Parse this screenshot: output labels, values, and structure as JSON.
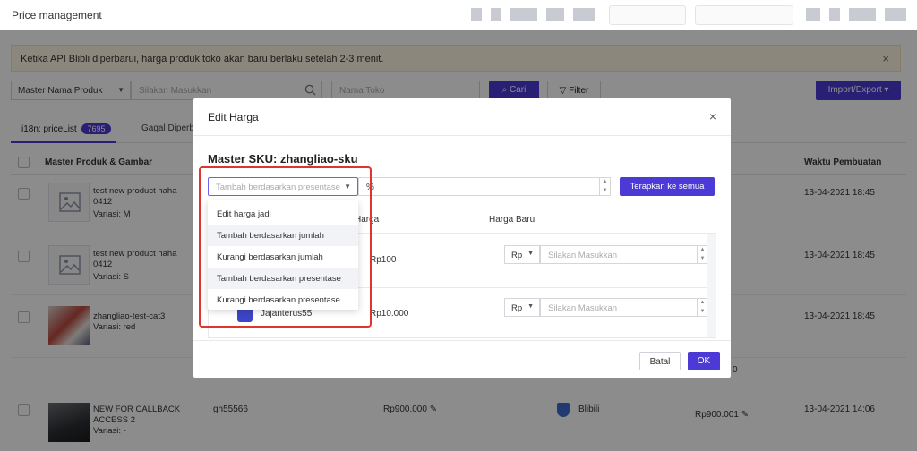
{
  "app": {
    "title": "Price management"
  },
  "notice": {
    "text": "Ketika API Blibli diperbarui, harga produk toko akan baru berlaku setelah 2-3 menit.",
    "close": "×"
  },
  "filters": {
    "master_select": "Master Nama Produk",
    "search_placeholder": "Silakan Masukkan",
    "store_placeholder": "Nama Toko",
    "search_button": "Cari",
    "filter_button": "Filter",
    "import_button": "Import/Export"
  },
  "tabs": [
    {
      "label": "i18n: priceList",
      "count": "7695"
    },
    {
      "label": "Gagal Diperb"
    }
  ],
  "table": {
    "headers": {
      "product": "Master Produk & Gambar",
      "created": "Waktu Pembuatan"
    },
    "rows": [
      {
        "name": "test new product haha 0412",
        "variant": "Variasi: M",
        "date": "13-04-2021 18:45"
      },
      {
        "name": "test new product haha 0412",
        "variant": "Variasi: S",
        "date": "13-04-2021 18:45"
      },
      {
        "name": "zhangliao-test-cat3",
        "variant": "Variasi: red",
        "date": "13-04-2021 18:45",
        "price_new": "0"
      },
      {
        "name": "NEW FOR CALLBACK ACCESS 2",
        "variant": "Variasi: -",
        "sku": "gh55566",
        "price": "Rp900.000",
        "store": "Blibili",
        "price_new": "Rp900.001",
        "date": "13-04-2021 14:06"
      }
    ]
  },
  "modal": {
    "title": "Edit Harga",
    "close": "×",
    "sku_label": "Master SKU: zhangliao-sku",
    "mode_placeholder": "Tambah berdasarkan presentase",
    "pct_suffix": "%",
    "apply_all": "Terapkan ke semua",
    "col_price": "Harga",
    "col_new_price": "Harga Baru",
    "rows": [
      {
        "store": "",
        "price": "Rp100",
        "currency": "Rp",
        "placeholder": "Silakan Masukkan"
      },
      {
        "store": "Jajanterus55",
        "price": "Rp10.000",
        "currency": "Rp",
        "placeholder": "Silakan Masukkan"
      }
    ],
    "cancel": "Batal",
    "ok": "OK"
  },
  "dropdown": {
    "options": [
      "Edit harga jadi",
      "Tambah berdasarkan jumlah",
      "Kurangi berdasarkan jumlah",
      "Tambah berdasarkan presentase",
      "Kurangi berdasarkan presentase"
    ]
  },
  "colors": {
    "accent": "#4b3ad6",
    "highlight": "#e0342c",
    "notice_bg": "#fdf6e3"
  }
}
